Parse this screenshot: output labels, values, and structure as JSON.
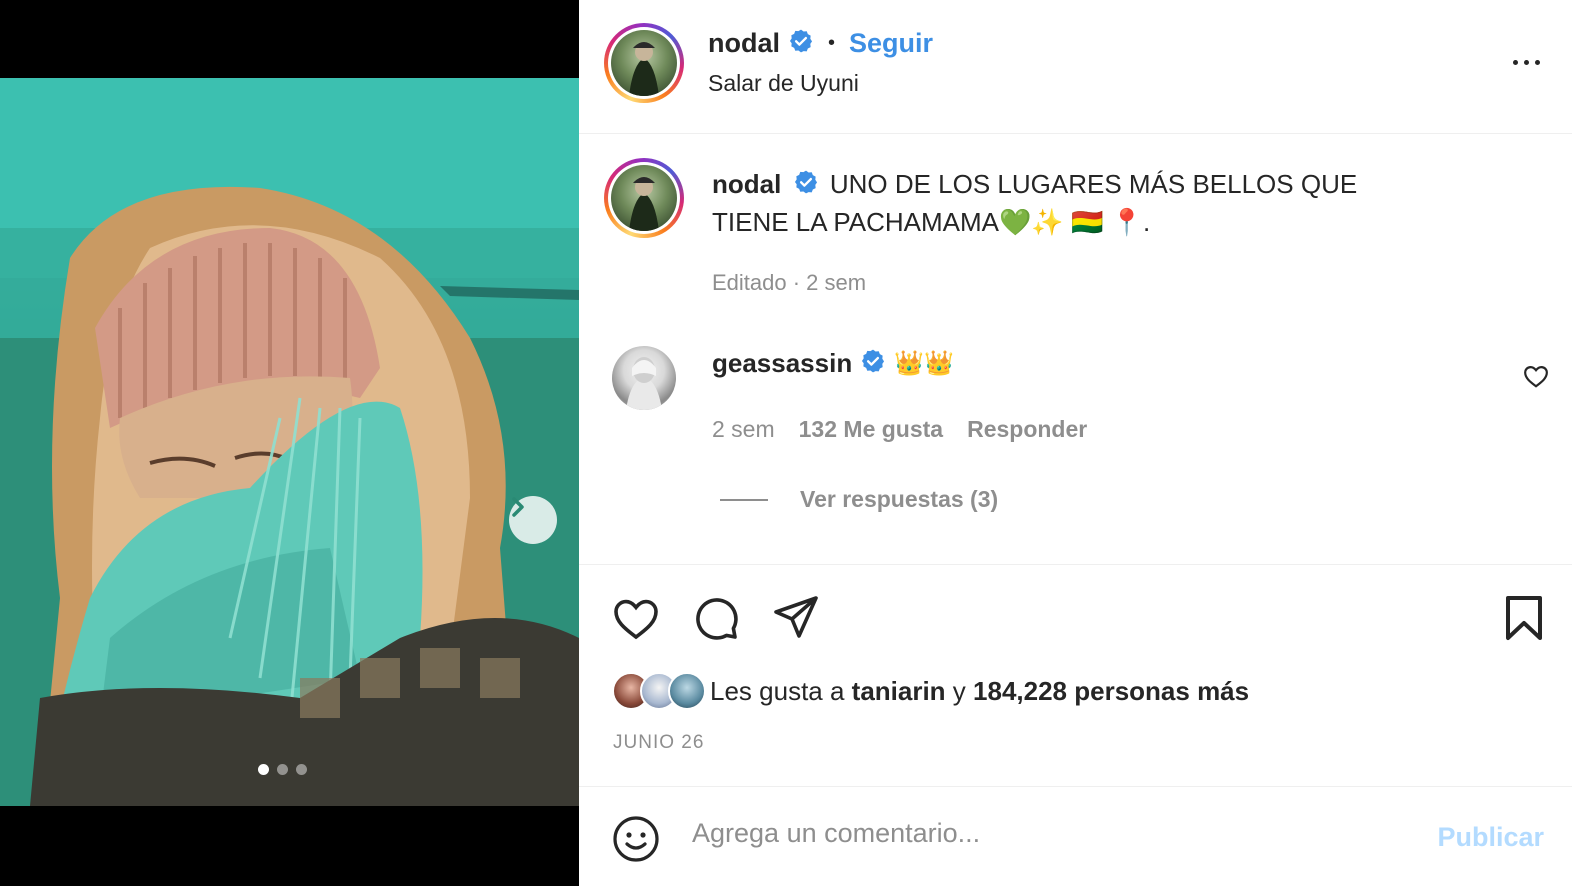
{
  "post": {
    "carousel": {
      "total": 3,
      "active": 1
    },
    "header": {
      "username": "nodal",
      "separator": "•",
      "follow_label": "Seguir",
      "location": "Salar de Uyuni"
    },
    "caption": {
      "username": "nodal",
      "text": "UNO DE LOS LUGARES MÁS BELLOS QUE TIENE LA PACHAMAMA💚✨ 🇧🇴 📍.",
      "meta": "Editado · 2 sem"
    },
    "comments": [
      {
        "username": "geassassin",
        "text": "👑👑",
        "time": "2 sem",
        "likes": "132 Me gusta",
        "reply_label": "Responder",
        "view_replies": "Ver respuestas (3)"
      }
    ],
    "likes": {
      "prefix": "Les gusta a ",
      "first_user": "taniarin",
      "connector": " y ",
      "count_text": "184,228 personas más"
    },
    "date": "JUNIO 26",
    "comment_input": {
      "placeholder": "Agrega un comentario...",
      "publish_label": "Publicar"
    }
  },
  "colors": {
    "accent": "#3d8fe4",
    "publish_disabled": "#b3dbff",
    "muted": "#8e8e8e",
    "text": "#262626"
  },
  "icons": [
    "verified-badge-icon",
    "more-options-icon",
    "heart-icon",
    "comment-icon",
    "share-icon",
    "bookmark-icon",
    "emoji-icon",
    "chevron-right-icon"
  ]
}
